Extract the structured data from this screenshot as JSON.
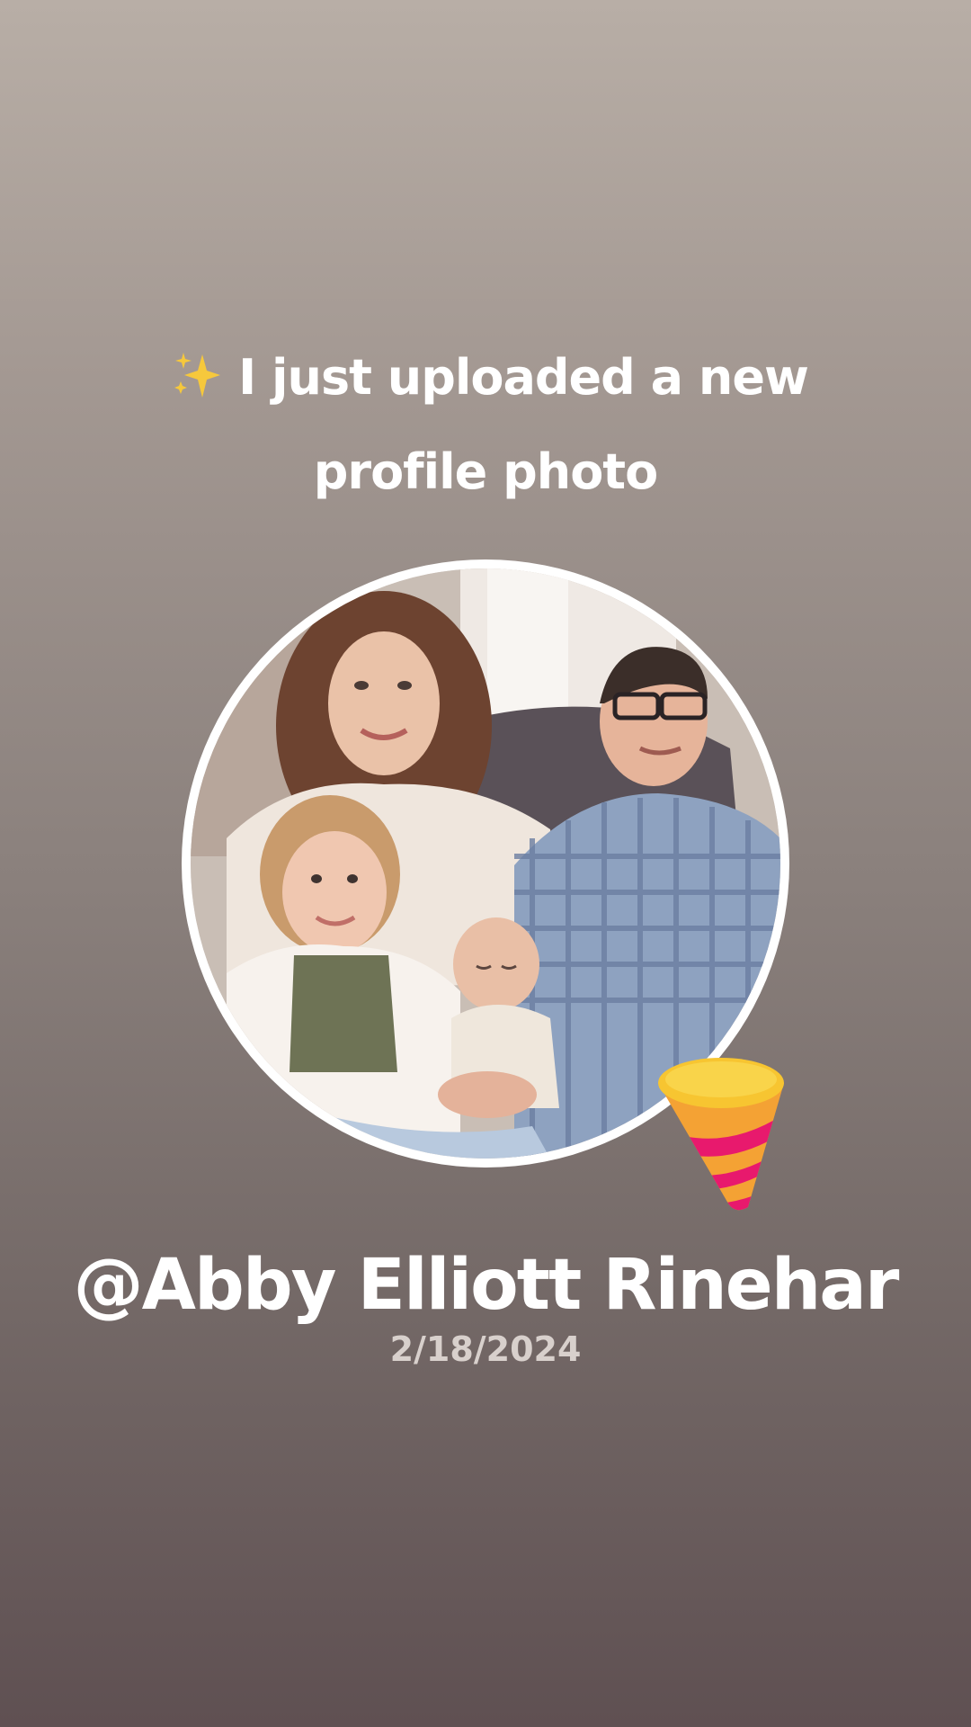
{
  "post": {
    "headline_line1": "I just uploaded a new",
    "headline_line2": "profile photo",
    "username": "@Abby Elliott Rinehar",
    "date": "2/18/2024"
  },
  "icons": {
    "headline_icon": "sparkles-icon",
    "decoration_icon": "party-popper-icon"
  },
  "colors": {
    "text": "#ffffff",
    "date_text": "#d8d0cc",
    "background_top": "#b8aea6",
    "background_bottom": "#5f5052",
    "avatar_border": "#ffffff"
  }
}
